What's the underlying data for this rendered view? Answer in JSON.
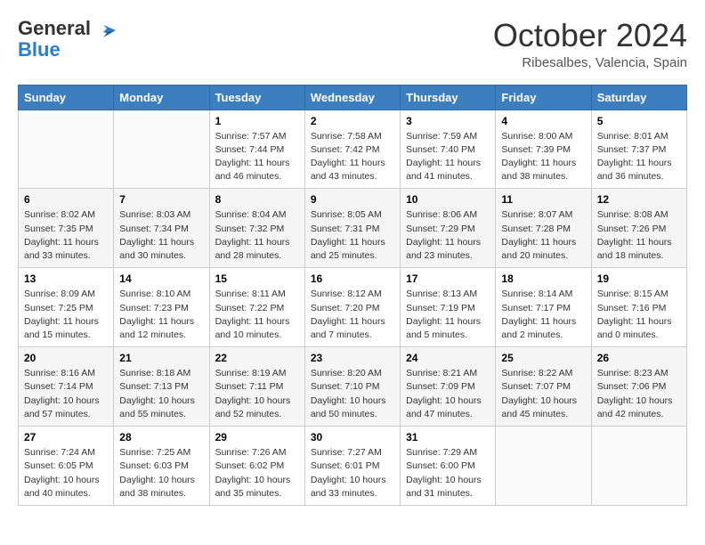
{
  "header": {
    "logo_line1": "General",
    "logo_line2": "Blue",
    "month": "October 2024",
    "location": "Ribesalbes, Valencia, Spain"
  },
  "weekdays": [
    "Sunday",
    "Monday",
    "Tuesday",
    "Wednesday",
    "Thursday",
    "Friday",
    "Saturday"
  ],
  "weeks": [
    [
      {
        "day": "",
        "info": ""
      },
      {
        "day": "",
        "info": ""
      },
      {
        "day": "1",
        "info": "Sunrise: 7:57 AM\nSunset: 7:44 PM\nDaylight: 11 hours and 46 minutes."
      },
      {
        "day": "2",
        "info": "Sunrise: 7:58 AM\nSunset: 7:42 PM\nDaylight: 11 hours and 43 minutes."
      },
      {
        "day": "3",
        "info": "Sunrise: 7:59 AM\nSunset: 7:40 PM\nDaylight: 11 hours and 41 minutes."
      },
      {
        "day": "4",
        "info": "Sunrise: 8:00 AM\nSunset: 7:39 PM\nDaylight: 11 hours and 38 minutes."
      },
      {
        "day": "5",
        "info": "Sunrise: 8:01 AM\nSunset: 7:37 PM\nDaylight: 11 hours and 36 minutes."
      }
    ],
    [
      {
        "day": "6",
        "info": "Sunrise: 8:02 AM\nSunset: 7:35 PM\nDaylight: 11 hours and 33 minutes."
      },
      {
        "day": "7",
        "info": "Sunrise: 8:03 AM\nSunset: 7:34 PM\nDaylight: 11 hours and 30 minutes."
      },
      {
        "day": "8",
        "info": "Sunrise: 8:04 AM\nSunset: 7:32 PM\nDaylight: 11 hours and 28 minutes."
      },
      {
        "day": "9",
        "info": "Sunrise: 8:05 AM\nSunset: 7:31 PM\nDaylight: 11 hours and 25 minutes."
      },
      {
        "day": "10",
        "info": "Sunrise: 8:06 AM\nSunset: 7:29 PM\nDaylight: 11 hours and 23 minutes."
      },
      {
        "day": "11",
        "info": "Sunrise: 8:07 AM\nSunset: 7:28 PM\nDaylight: 11 hours and 20 minutes."
      },
      {
        "day": "12",
        "info": "Sunrise: 8:08 AM\nSunset: 7:26 PM\nDaylight: 11 hours and 18 minutes."
      }
    ],
    [
      {
        "day": "13",
        "info": "Sunrise: 8:09 AM\nSunset: 7:25 PM\nDaylight: 11 hours and 15 minutes."
      },
      {
        "day": "14",
        "info": "Sunrise: 8:10 AM\nSunset: 7:23 PM\nDaylight: 11 hours and 12 minutes."
      },
      {
        "day": "15",
        "info": "Sunrise: 8:11 AM\nSunset: 7:22 PM\nDaylight: 11 hours and 10 minutes."
      },
      {
        "day": "16",
        "info": "Sunrise: 8:12 AM\nSunset: 7:20 PM\nDaylight: 11 hours and 7 minutes."
      },
      {
        "day": "17",
        "info": "Sunrise: 8:13 AM\nSunset: 7:19 PM\nDaylight: 11 hours and 5 minutes."
      },
      {
        "day": "18",
        "info": "Sunrise: 8:14 AM\nSunset: 7:17 PM\nDaylight: 11 hours and 2 minutes."
      },
      {
        "day": "19",
        "info": "Sunrise: 8:15 AM\nSunset: 7:16 PM\nDaylight: 11 hours and 0 minutes."
      }
    ],
    [
      {
        "day": "20",
        "info": "Sunrise: 8:16 AM\nSunset: 7:14 PM\nDaylight: 10 hours and 57 minutes."
      },
      {
        "day": "21",
        "info": "Sunrise: 8:18 AM\nSunset: 7:13 PM\nDaylight: 10 hours and 55 minutes."
      },
      {
        "day": "22",
        "info": "Sunrise: 8:19 AM\nSunset: 7:11 PM\nDaylight: 10 hours and 52 minutes."
      },
      {
        "day": "23",
        "info": "Sunrise: 8:20 AM\nSunset: 7:10 PM\nDaylight: 10 hours and 50 minutes."
      },
      {
        "day": "24",
        "info": "Sunrise: 8:21 AM\nSunset: 7:09 PM\nDaylight: 10 hours and 47 minutes."
      },
      {
        "day": "25",
        "info": "Sunrise: 8:22 AM\nSunset: 7:07 PM\nDaylight: 10 hours and 45 minutes."
      },
      {
        "day": "26",
        "info": "Sunrise: 8:23 AM\nSunset: 7:06 PM\nDaylight: 10 hours and 42 minutes."
      }
    ],
    [
      {
        "day": "27",
        "info": "Sunrise: 7:24 AM\nSunset: 6:05 PM\nDaylight: 10 hours and 40 minutes."
      },
      {
        "day": "28",
        "info": "Sunrise: 7:25 AM\nSunset: 6:03 PM\nDaylight: 10 hours and 38 minutes."
      },
      {
        "day": "29",
        "info": "Sunrise: 7:26 AM\nSunset: 6:02 PM\nDaylight: 10 hours and 35 minutes."
      },
      {
        "day": "30",
        "info": "Sunrise: 7:27 AM\nSunset: 6:01 PM\nDaylight: 10 hours and 33 minutes."
      },
      {
        "day": "31",
        "info": "Sunrise: 7:29 AM\nSunset: 6:00 PM\nDaylight: 10 hours and 31 minutes."
      },
      {
        "day": "",
        "info": ""
      },
      {
        "day": "",
        "info": ""
      }
    ]
  ]
}
